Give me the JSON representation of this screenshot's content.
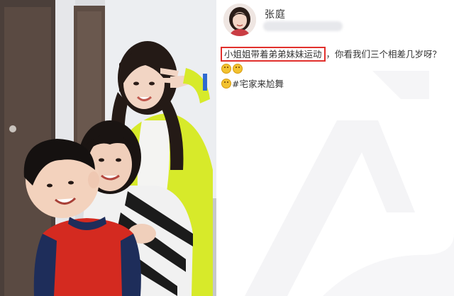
{
  "post": {
    "username": "张庭",
    "highlighted_text": "小姐姐带着弟弟妹妹运动",
    "body_text": "，你看我们三个相差几岁呀？",
    "hashtag": "#宅家来尬舞",
    "emoji_name": "smile-emoji"
  },
  "photo": {
    "description_icon": "family-photo"
  },
  "colors": {
    "highlight_border": "#e1302c",
    "text": "#333333",
    "watermark": "#f3f3f5"
  }
}
